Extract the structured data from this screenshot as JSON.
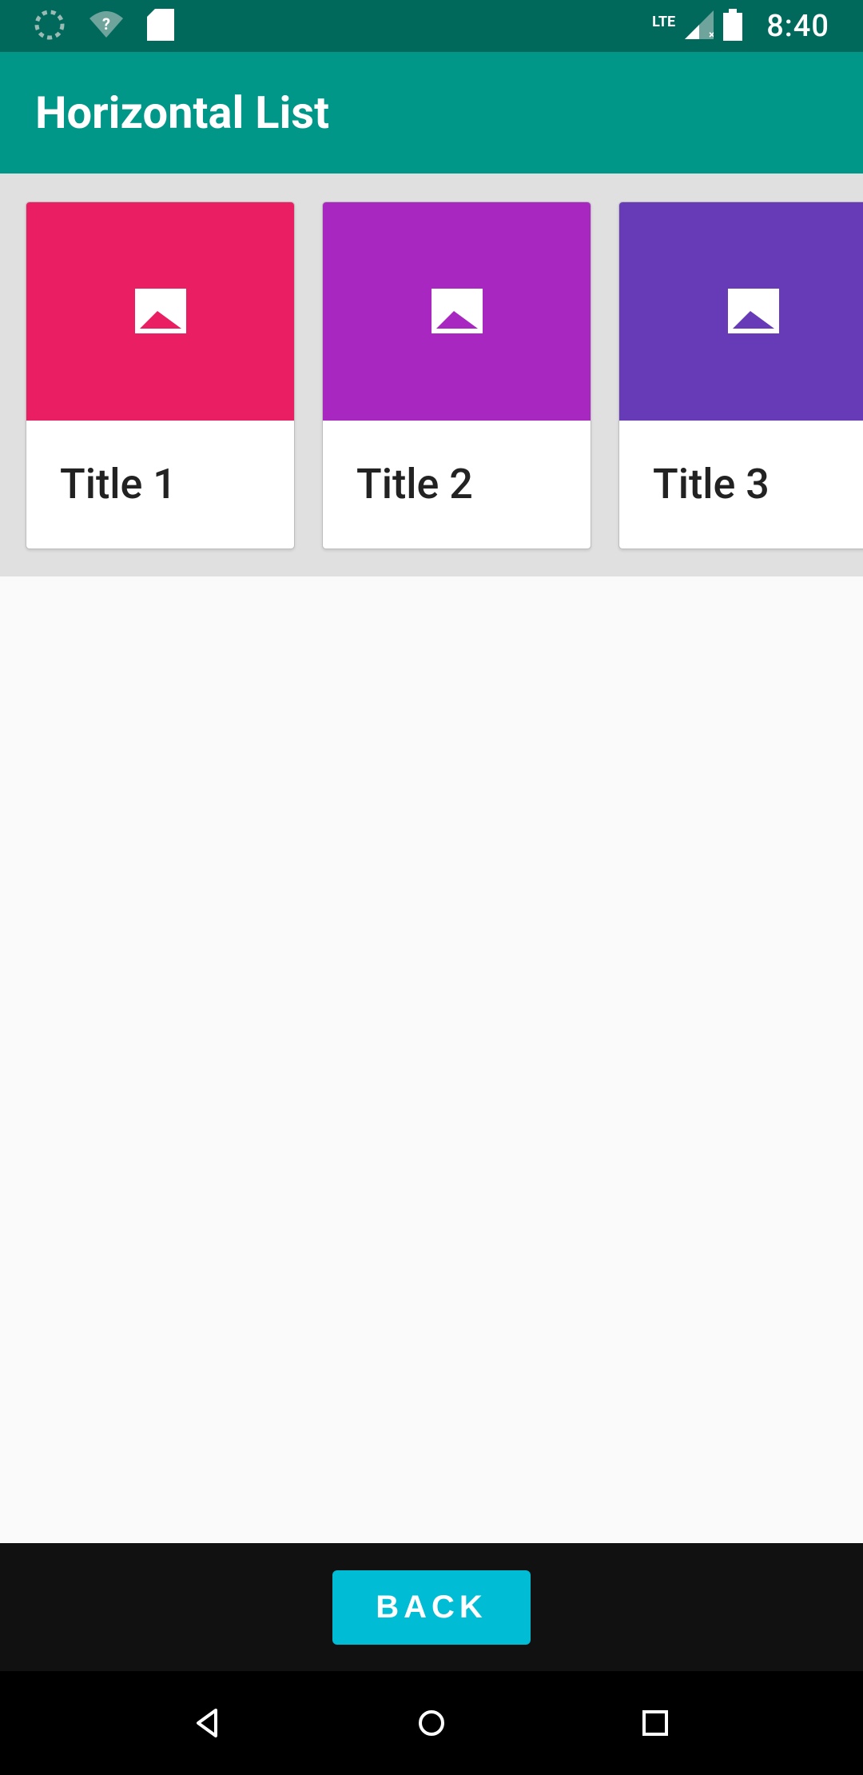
{
  "status": {
    "time": "8:40",
    "lte_label": "LTE",
    "icons": {
      "spinner": "spinner-icon",
      "wifi": "wifi-question-icon",
      "sd": "sd-card-icon",
      "signal": "signal-icon",
      "battery": "battery-full-icon"
    }
  },
  "app_bar": {
    "title": "Horizontal List"
  },
  "list": {
    "items": [
      {
        "title": "Title 1",
        "color": "#e91e63",
        "icon": "image-placeholder-icon"
      },
      {
        "title": "Title 2",
        "color": "#a927c1",
        "icon": "image-placeholder-icon"
      },
      {
        "title": "Title 3",
        "color": "#673ab7",
        "icon": "image-placeholder-icon"
      }
    ]
  },
  "bottom": {
    "back_label": "BACK"
  },
  "nav": {
    "back": "nav-back-icon",
    "home": "nav-home-icon",
    "recent": "nav-recent-icon"
  }
}
